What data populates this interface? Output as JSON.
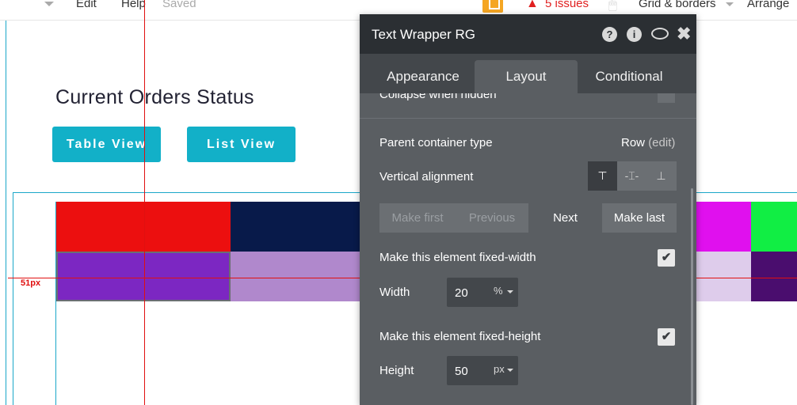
{
  "toolbar": {
    "edit_label": "Edit",
    "help_label": "Help",
    "status_label": "Saved",
    "issues_label": "5 issues",
    "warning_glyph": "▲",
    "pointer_glyph": "🖱",
    "grid_label": "Grid & borders",
    "arrange_label": "Arrange"
  },
  "canvas": {
    "page_title": "Current Orders Status",
    "buttons": {
      "table_view": "Table View",
      "list_view": "List View"
    },
    "guide_label": "51px",
    "swatch_colors": {
      "row1": [
        "#ec0f0f",
        "#081a4a",
        "#e010ee",
        "#11ee44"
      ],
      "row2": [
        "#7c27c2",
        "#b088cc",
        "#decceb",
        "#4a0d6e"
      ],
      "accent": "#12b0c8",
      "guide": "#e01010"
    }
  },
  "panel": {
    "title": "Text Wrapper RG",
    "header_icons": [
      "help-icon",
      "info-icon",
      "comment-icon",
      "close-icon"
    ],
    "help_glyph": "?",
    "info_glyph": "i",
    "close_glyph": "✖",
    "tabs": {
      "appearance": "Appearance",
      "layout": "Layout",
      "conditional": "Conditional"
    },
    "active_tab": "Layout",
    "collapse_label": "Collapse when hidden",
    "parent_container_label": "Parent container type",
    "parent_container_value": "Row",
    "parent_container_edit": "(edit)",
    "vertical_alignment_label": "Vertical alignment",
    "vertical_alignment_selected": "top",
    "valign_glyphs": {
      "top": "⊤",
      "center": "-⌶-",
      "bottom": "⊥"
    },
    "order_buttons": {
      "make_first": "Make first",
      "previous": "Previous",
      "next": "Next",
      "make_last": "Make last"
    },
    "fixed_width_label": "Make this element fixed-width",
    "fixed_width_checked": true,
    "width_label": "Width",
    "width_value": "20",
    "width_unit": "%",
    "fixed_height_label": "Make this element fixed-height",
    "fixed_height_checked": true,
    "height_label": "Height",
    "height_value": "50",
    "height_unit": "px",
    "check_glyph": "✔"
  }
}
